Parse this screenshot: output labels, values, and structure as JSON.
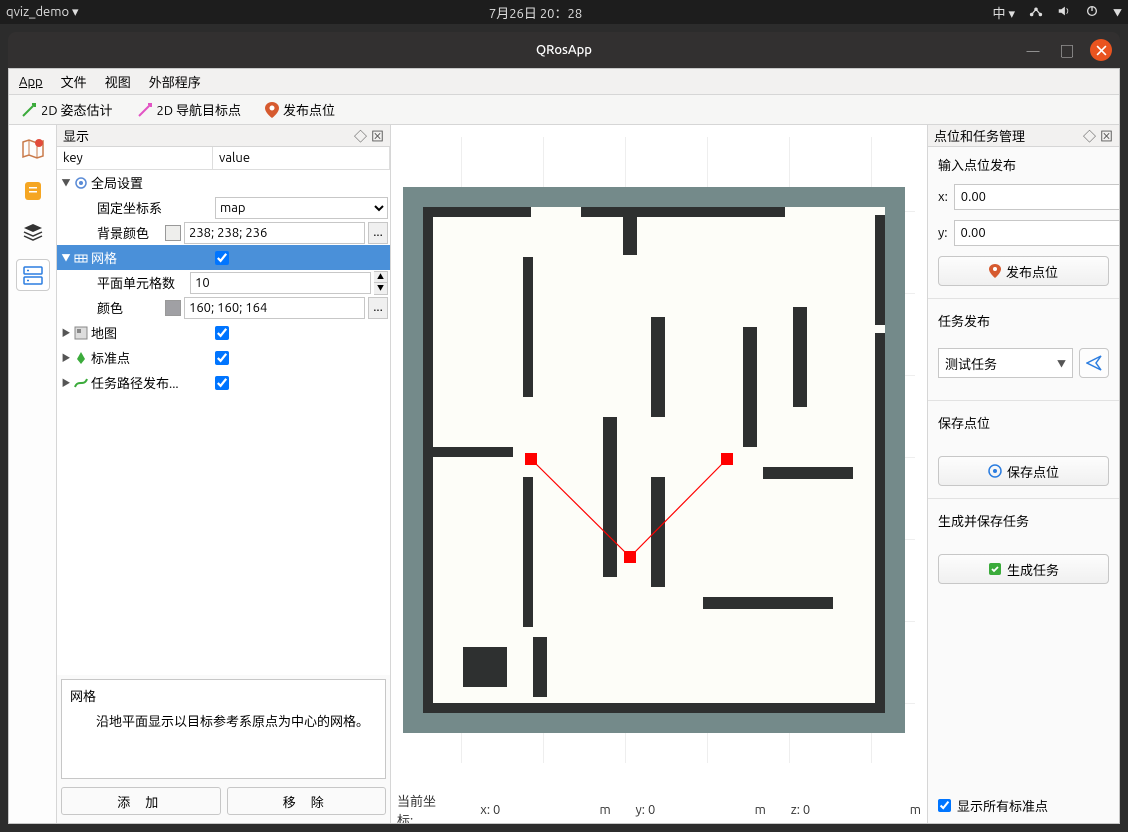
{
  "taskbar": {
    "app": "qviz_demo ▾",
    "date": "7月26日 20：28",
    "ime": "中 ▾"
  },
  "window": {
    "title": "QRosApp"
  },
  "menu": [
    "App",
    "文件",
    "视图",
    "外部程序"
  ],
  "toolbar": {
    "pose": "2D 姿态估计",
    "goal": "2D 导航目标点",
    "pub": "发布点位"
  },
  "dock": {
    "display": "显示",
    "right": "点位和任务管理"
  },
  "treehdr": {
    "k": "key",
    "v": "value"
  },
  "tree": {
    "global": "全局设置",
    "fixed": "固定坐标系",
    "fixed_v": "map",
    "bg": "背景颜色",
    "bg_v": "238; 238; 236",
    "grid": "网格",
    "cells": "平面单元格数",
    "cells_v": "10",
    "color": "颜色",
    "color_v": "160; 160; 164",
    "map": "地图",
    "marker": "标准点",
    "path": "任务路径发布..."
  },
  "desc": {
    "title": "网格",
    "body": "沿地平面显示以目标参考系原点为中心的网格。"
  },
  "btns": {
    "add": "添 加",
    "remove": "移 除"
  },
  "status": {
    "label": "当前坐标:",
    "x": "x: 0",
    "y": "y: 0",
    "z": "z: 0",
    "unit": "m"
  },
  "right": {
    "input_title": "输入点位发布",
    "x": "x:",
    "y": "y:",
    "xv": "0.00",
    "yv": "0.00",
    "pub": "发布点位",
    "task_title": "任务发布",
    "task_sel": "测试任务",
    "save_title": "保存点位",
    "save_btn": "保存点位",
    "gen_title": "生成并保存任务",
    "gen_btn": "生成任务",
    "show_all": "显示所有标准点"
  }
}
